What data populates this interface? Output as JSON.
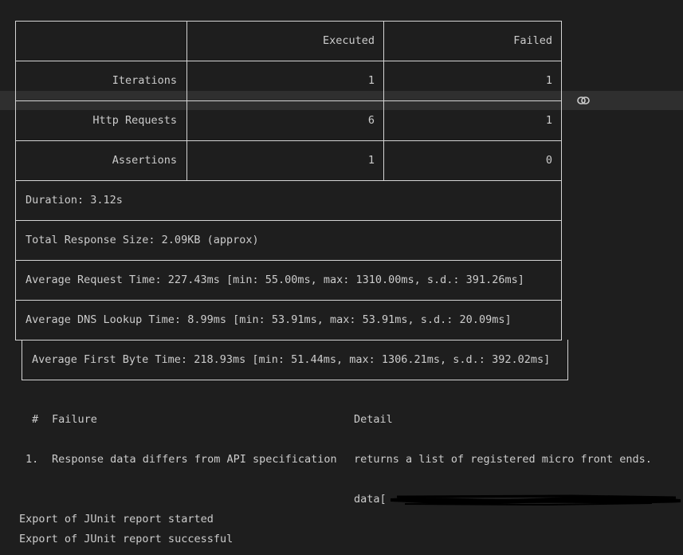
{
  "table": {
    "columns": [
      "",
      "Executed",
      "Failed"
    ],
    "rows": [
      {
        "label": "Iterations",
        "executed": "1",
        "failed": "1"
      },
      {
        "label": "Http Requests",
        "executed": "6",
        "failed": "1"
      },
      {
        "label": "Assertions",
        "executed": "1",
        "failed": "0"
      }
    ],
    "summary": [
      "Duration: 3.12s",
      "Total Response Size: 2.09KB (approx)",
      "Average Request Time: 227.43ms [min: 55.00ms, max: 1310.00ms, s.d.: 391.26ms]",
      "Average DNS Lookup Time: 8.99ms [min: 53.91ms, max: 53.91ms, s.d.: 20.09ms]",
      "Average First Byte Time: 218.93ms [min: 51.44ms, max: 1306.21ms, s.d.: 392.02ms]"
    ]
  },
  "failures": {
    "headers": {
      "num": "#",
      "failure": "Failure",
      "detail": "Detail"
    },
    "items": [
      {
        "num": "1.",
        "failure": "Response data differs from API specification",
        "detail": "returns a list of registered micro front ends.",
        "extra": "data["
      }
    ]
  },
  "log": [
    "Export of JUnit report started",
    "Export of JUnit report successful"
  ],
  "icons": {
    "link": "link-icon"
  }
}
